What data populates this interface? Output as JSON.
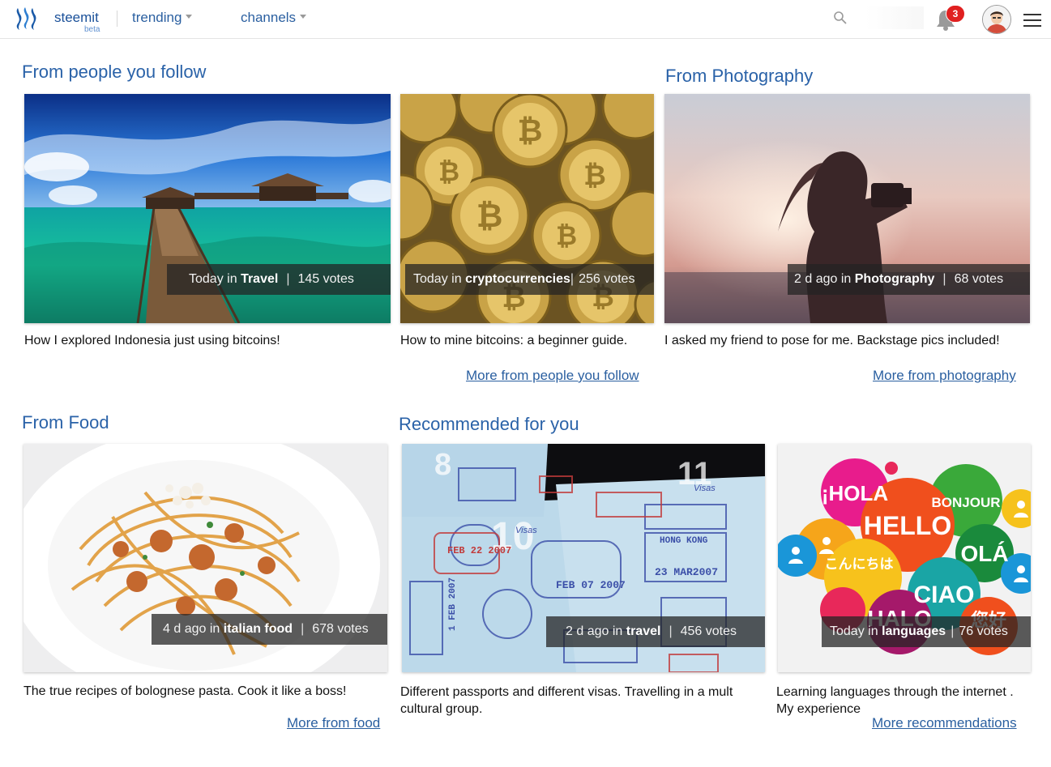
{
  "header": {
    "brand": "steemit",
    "beta": "beta",
    "nav": [
      {
        "label": "trending"
      },
      {
        "label": "channels"
      }
    ],
    "notifications_count": "3"
  },
  "sections": {
    "follow": {
      "title": "From people you follow",
      "more": "More from people you follow",
      "cards": [
        {
          "time": "Today",
          "in": "in",
          "category": "Travel",
          "votes": "145 votes",
          "caption": "How I explored Indonesia just using bitcoins!"
        },
        {
          "time": "Today",
          "in": "in",
          "category": "cryptocurrencies",
          "votes": "256 votes",
          "caption": "How to mine bitcoins: a beginner guide."
        }
      ]
    },
    "photography": {
      "title": "From Photography",
      "more": "More from photography",
      "cards": [
        {
          "time": "2 d ago",
          "in": "in",
          "category": "Photography",
          "votes": "68 votes",
          "caption": "I asked my friend to pose for me. Backstage pics included!"
        }
      ]
    },
    "food": {
      "title": "From Food",
      "more": "More from food",
      "cards": [
        {
          "time": "4 d ago",
          "in": "in",
          "category": "italian food",
          "votes": "678 votes",
          "caption": "The true recipes of bolognese pasta. Cook it like a boss!"
        }
      ]
    },
    "recommended": {
      "title": "Recommended for you",
      "more": "More recommendations",
      "cards": [
        {
          "time": "2  d ago",
          "in": "in",
          "category": "travel",
          "votes": "456 votes",
          "caption_line1": "Different passports and different visas. Travelling in a mult",
          "caption_line2": "cultural group."
        },
        {
          "time": "Today",
          "in": "in",
          "category": "languages",
          "votes": "76 votes",
          "caption_line1": "Learning languages through the internet .",
          "caption_line2": "My experience"
        }
      ]
    }
  },
  "image_text": {
    "bubbles": [
      "¡HOLA",
      "HELLO",
      "BONJOUR",
      "OLÁ",
      "こんにちは",
      "CIAO",
      "HALO",
      "您好"
    ],
    "passport": [
      "8",
      "10",
      "11",
      "Visas",
      "FEB 22 2007",
      "23 MAR2007",
      "FEB 07 2007",
      "HONG KONG",
      "1 FEB 2007"
    ]
  }
}
